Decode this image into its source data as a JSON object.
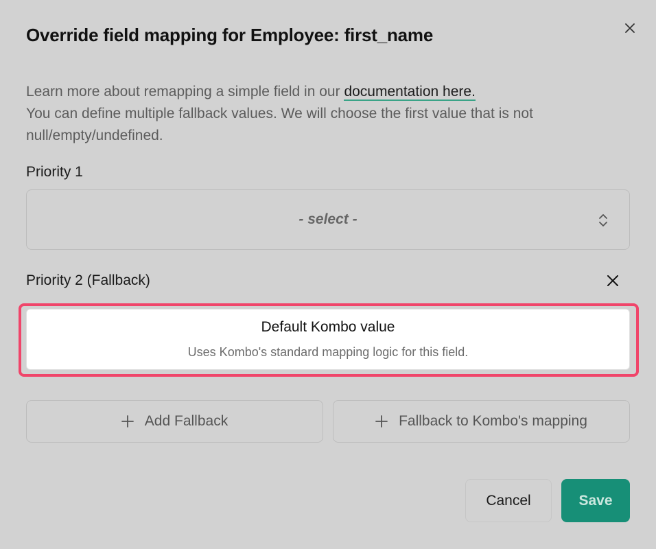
{
  "modal": {
    "title": "Override field mapping for Employee: first_name",
    "description": {
      "line1_prefix": "Learn more about remapping a simple field in our ",
      "link_text": "documentation here.",
      "line2": "You can define multiple fallback values. We will choose the first value that is not null/empty/undefined."
    }
  },
  "priority1": {
    "label": "Priority 1",
    "select_value": "- select -"
  },
  "priority2": {
    "label": "Priority 2 (Fallback)",
    "card_title": "Default Kombo value",
    "card_subtitle": "Uses Kombo's standard mapping logic for this field."
  },
  "actions": {
    "add_fallback": "Add Fallback",
    "fallback_kombo": "Fallback to Kombo's mapping",
    "cancel": "Cancel",
    "save": "Save"
  },
  "colors": {
    "accent": "#178f77",
    "highlight": "#f0456a",
    "link_underline": "#3aa387"
  },
  "icons": {
    "close": "close-icon",
    "plus": "plus-icon",
    "select_arrows": "chevron-up-down-icon"
  }
}
